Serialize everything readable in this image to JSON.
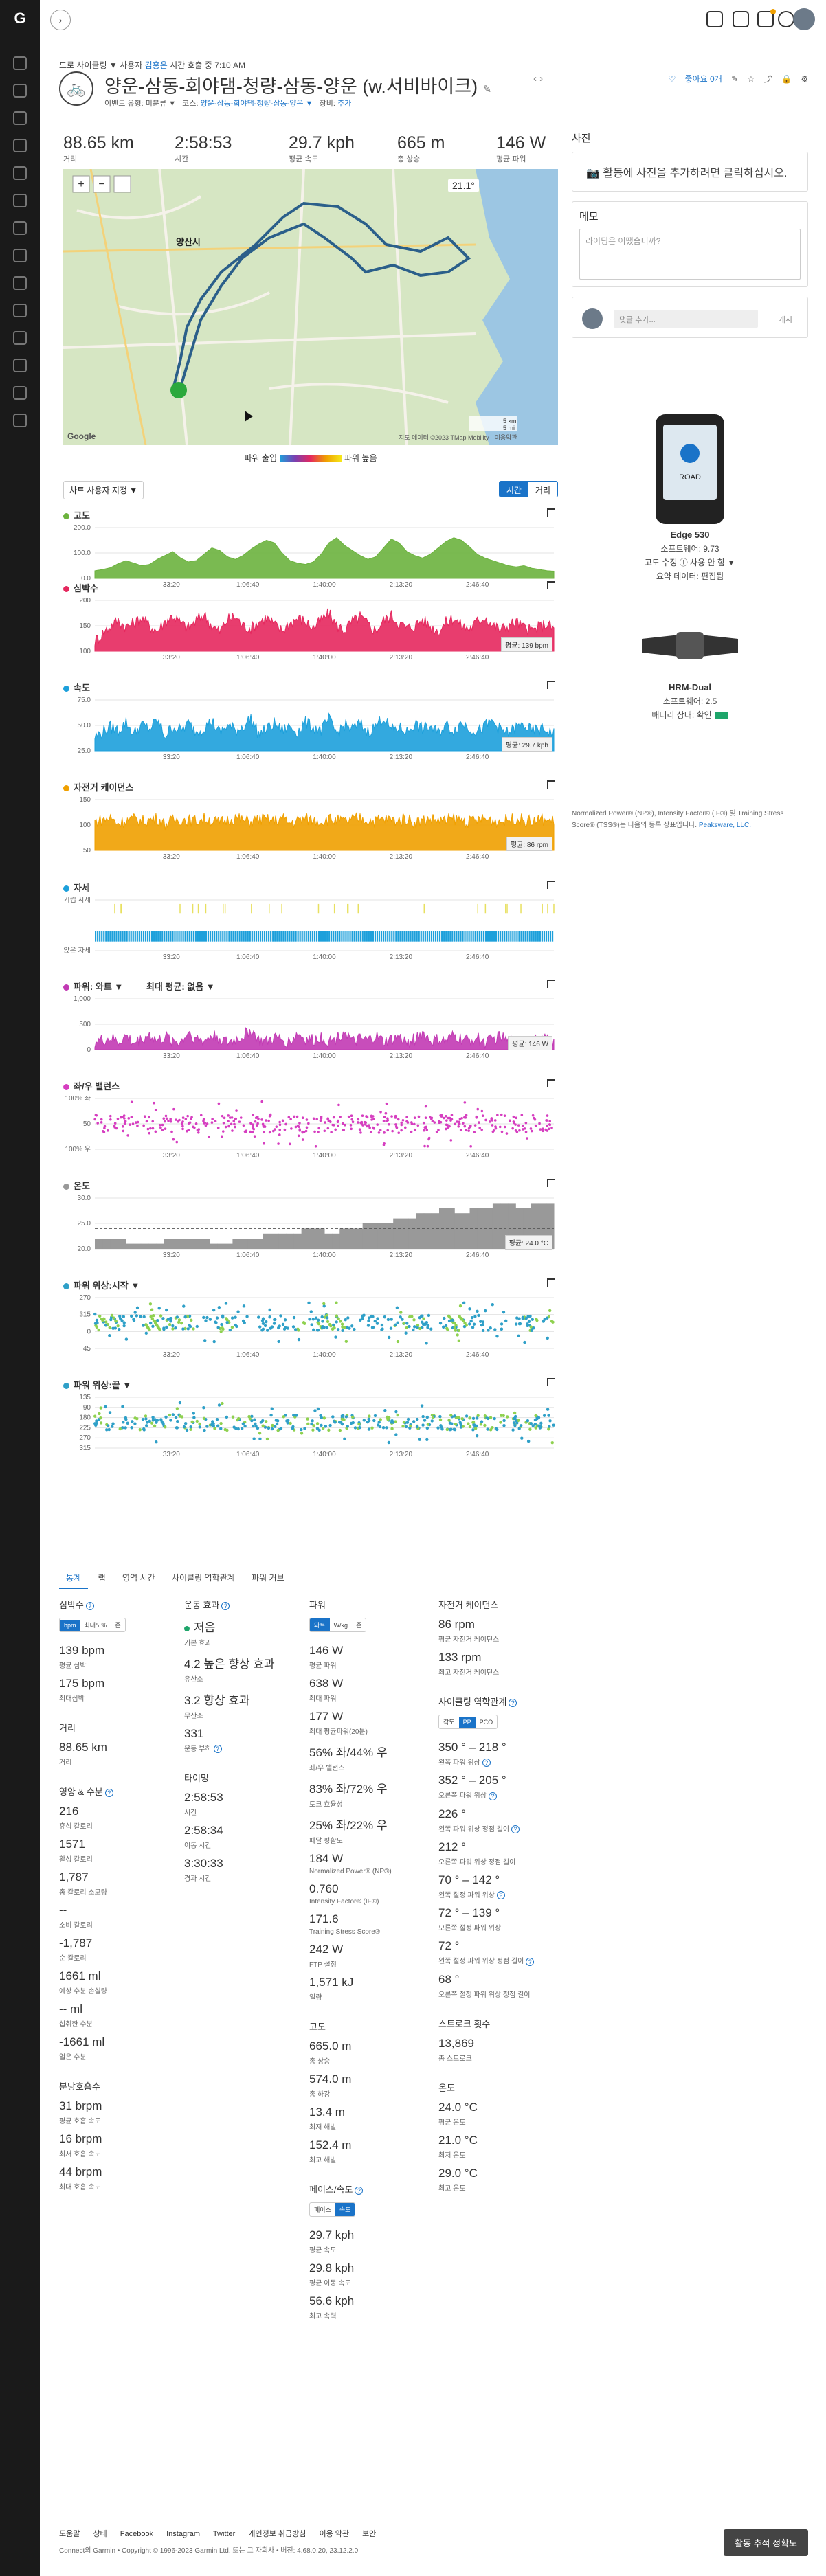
{
  "nav": {
    "logo": "G"
  },
  "header": {
    "toggle_icon": "chevron-right-icon"
  },
  "breadcrumb": {
    "category": "도로 사이클링",
    "created_by": "▼ 사용자",
    "link": "김홍은",
    "time_note": "시간 호출 중 7:10 AM"
  },
  "activity": {
    "title": "양운-삼동-회야댐-청량-삼동-양운 (w.서비바이크)",
    "edit_icon": "pencil-icon",
    "event_label": "이벤트 유형:",
    "event_value": "미분류 ▼",
    "course_label": "코스:",
    "course_value": "양운-삼동-회야댐-청량-삼동-양운 ▼",
    "gear_label": "장비:",
    "gear_value": "추가",
    "likes": "좋아요 0개",
    "pager": "‹   ›"
  },
  "stats": [
    {
      "value": "88.65 km",
      "label": "거리"
    },
    {
      "value": "2:58:53",
      "label": "시간"
    },
    {
      "value": "29.7 kph",
      "label": "평균 속도"
    },
    {
      "value": "665 m",
      "label": "총 상승"
    },
    {
      "value": "146 W",
      "label": "평균 파워"
    }
  ],
  "map": {
    "temperature": "21.1°",
    "attribution": "지도 데이터 ©2023 TMap Mobility · 이용약관",
    "google": "Google",
    "scale_a": "5 km",
    "scale_b": "5 mi",
    "city_label": "양산시"
  },
  "legend": {
    "low": "파워 출입",
    "high": "파워 높음"
  },
  "controls": {
    "overlay_select": "차트 사용자 지정 ▼",
    "time_label": "시간",
    "distance_label": "거리"
  },
  "charts": [
    {
      "key": "elev",
      "title": "고도",
      "color": "#6cb33e",
      "type": "area",
      "yticks": [
        "200.0",
        "100.0",
        "0.0"
      ],
      "ymax": 200,
      "values": [
        30,
        35,
        42,
        58,
        70,
        60,
        50,
        55,
        75,
        90,
        105,
        80,
        65,
        70,
        95,
        120,
        110,
        85,
        75,
        90,
        115,
        135,
        150,
        140,
        100,
        70,
        60,
        55,
        65,
        95,
        140,
        160,
        130,
        110,
        90,
        75,
        85,
        120,
        155,
        140,
        105,
        90,
        80,
        95,
        120,
        145,
        160,
        150,
        125,
        95,
        80,
        70,
        60,
        50,
        45,
        50,
        40,
        35,
        30,
        28
      ],
      "badge": ""
    },
    {
      "key": "hr",
      "title": "심박수",
      "color": "#e5285e",
      "type": "area",
      "yticks": [
        "200",
        "150",
        "100"
      ],
      "ymin": 100,
      "ymax": 200,
      "values": [
        120,
        135,
        150,
        160,
        148,
        155,
        165,
        150,
        140,
        158,
        170,
        155,
        145,
        160,
        172,
        150,
        138,
        162,
        168,
        150,
        145,
        158,
        166,
        152,
        140,
        155,
        165,
        158,
        146,
        160,
        174,
        150,
        142,
        158,
        168,
        152,
        140,
        160,
        170,
        155,
        145,
        150,
        162,
        148,
        140,
        156,
        166,
        150,
        144,
        158,
        168,
        150,
        142,
        150,
        158,
        146,
        140,
        148,
        154,
        140
      ],
      "badge": "평균: 139 bpm"
    },
    {
      "key": "spd",
      "title": "속도",
      "color": "#1da0db",
      "type": "area",
      "yticks": [
        "75.0",
        "50.0",
        "25.0"
      ],
      "ymax": 75,
      "values": [
        20,
        28,
        35,
        30,
        42,
        25,
        38,
        32,
        45,
        22,
        36,
        30,
        40,
        28,
        34,
        44,
        26,
        38,
        30,
        36,
        48,
        24,
        32,
        40,
        30,
        36,
        28,
        42,
        34,
        30,
        46,
        26,
        38,
        32,
        40,
        28,
        36,
        50,
        30,
        34,
        28,
        40,
        32,
        36,
        26,
        38,
        30,
        42,
        34,
        28,
        36,
        44,
        30,
        26,
        34,
        38,
        28,
        32,
        30,
        24
      ],
      "badge": "평균: 29.7 kph"
    },
    {
      "key": "cad",
      "title": "자전거 케이던스",
      "color": "#f0a000",
      "type": "area",
      "yticks": [
        "150",
        "100",
        "50"
      ],
      "ymax": 150,
      "values": [
        85,
        90,
        95,
        80,
        88,
        92,
        86,
        90,
        94,
        78,
        88,
        92,
        90,
        86,
        94,
        88,
        82,
        90,
        96,
        88,
        84,
        92,
        90,
        86,
        94,
        80,
        88,
        92,
        90,
        86,
        92,
        88,
        84,
        90,
        94,
        88,
        86,
        92,
        90,
        88,
        94,
        82,
        88,
        92,
        90,
        86,
        94,
        88,
        84,
        90,
        92,
        88,
        86,
        90,
        94,
        88,
        84,
        90,
        88,
        86
      ],
      "badge": "평균: 86 rpm"
    },
    {
      "key": "pos",
      "title": "자세",
      "color": "#1da0db",
      "type": "posture",
      "yticks": [
        "기립 자세",
        "앉은 자세"
      ],
      "ymax": 1,
      "values": [],
      "badge": ""
    },
    {
      "key": "pwr",
      "title": "파워: 와트 ▼",
      "title2": "최대 평균: 없음 ▼",
      "color": "#c23ab4",
      "type": "area",
      "yticks": [
        "1,000",
        "500",
        "0"
      ],
      "ymax": 1000,
      "values": [
        150,
        180,
        220,
        140,
        260,
        120,
        200,
        300,
        160,
        240,
        180,
        140,
        350,
        200,
        160,
        280,
        220,
        130,
        190,
        260,
        400,
        170,
        150,
        230,
        190,
        140,
        310,
        200,
        180,
        250,
        160,
        220,
        380,
        140,
        200,
        170,
        260,
        150,
        190,
        240,
        120,
        210,
        330,
        160,
        190,
        150,
        270,
        200,
        180,
        230,
        140,
        200,
        260,
        150,
        170,
        220,
        130,
        180,
        200,
        140
      ],
      "badge": "평균: 146 W"
    },
    {
      "key": "bal",
      "title": "좌/우 밸런스",
      "color": "#d63ec0",
      "type": "scatter",
      "yticks": [
        "100% 좌",
        "50",
        "100% 우"
      ],
      "ymax": 100,
      "values": [],
      "badge": ""
    },
    {
      "key": "temp",
      "title": "온도",
      "color": "#999999",
      "type": "step",
      "yticks": [
        "30.0",
        "25.0",
        "20.0"
      ],
      "ymin": 20,
      "ymax": 30,
      "values": [
        22,
        22,
        22,
        22,
        21,
        21,
        21,
        21,
        21,
        22,
        22,
        22,
        22,
        22,
        22,
        21,
        21,
        21,
        22,
        22,
        22,
        22,
        23,
        23,
        23,
        23,
        23,
        24,
        24,
        24,
        23,
        23,
        24,
        24,
        24,
        25,
        25,
        25,
        25,
        26,
        26,
        26,
        27,
        27,
        27,
        28,
        28,
        27,
        27,
        28,
        28,
        28,
        29,
        29,
        29,
        28,
        28,
        29,
        29,
        29
      ],
      "badge": "평균: 24.0 °C"
    },
    {
      "key": "ppstart",
      "title": "파워 위상:시작 ▼",
      "color": "#2fa0c8",
      "type": "dual",
      "yticks": [
        "270",
        "315",
        "0",
        "45"
      ],
      "ymax": 1,
      "values": [],
      "badge": ""
    },
    {
      "key": "ppend",
      "title": "파워 위상:끝 ▼",
      "color": "#2fa0c8",
      "type": "dual",
      "yticks": [
        "135",
        "90",
        "180",
        "225",
        "270",
        "315"
      ],
      "ymax": 1,
      "values": [],
      "badge": ""
    }
  ],
  "chart_axis": {
    "xticks": [
      "33:20",
      "1:06:40",
      "1:40:00",
      "2:13:20",
      "2:46:40"
    ]
  },
  "tabs": [
    "통계",
    "랩",
    "영역 시간",
    "사이클링 역학관계",
    "파워 커브"
  ],
  "stat_columns": [
    [
      {
        "kind": "head",
        "text": "심박수",
        "qm": true
      },
      {
        "kind": "toggle",
        "items": [
          "bpm",
          "최대도%",
          "존"
        ],
        "on": 0
      },
      {
        "kind": "val",
        "v": "139 bpm",
        "l": "평균 심박"
      },
      {
        "kind": "val",
        "v": "175 bpm",
        "l": "최대심박"
      },
      {
        "kind": "head",
        "text": "거리",
        "gap": true
      },
      {
        "kind": "val",
        "v": "88.65 km",
        "l": "거리"
      },
      {
        "kind": "head",
        "text": "영양 & 수분",
        "qm": true,
        "gap": true
      },
      {
        "kind": "val",
        "v": "216",
        "l": "휴식 칼로리"
      },
      {
        "kind": "val",
        "v": "1571",
        "l": "활성 칼로리"
      },
      {
        "kind": "val",
        "v": "1,787",
        "l": "총 칼로리 소모량"
      },
      {
        "kind": "val",
        "v": "--",
        "l": "소비 칼로리"
      },
      {
        "kind": "val",
        "v": "-1,787",
        "l": "순 칼로리"
      },
      {
        "kind": "val",
        "v": "1661 ml",
        "l": "예상 수분 손실량"
      },
      {
        "kind": "val",
        "v": "-- ml",
        "l": "섭취한 수분"
      },
      {
        "kind": "val",
        "v": "-1661 ml",
        "l": "얼은 수분"
      },
      {
        "kind": "head",
        "text": "분당호흡수",
        "gap": true
      },
      {
        "kind": "val",
        "v": "31 brpm",
        "l": "평균 호흡 속도"
      },
      {
        "kind": "val",
        "v": "16 brpm",
        "l": "최저 호흡 속도"
      },
      {
        "kind": "val",
        "v": "44 brpm",
        "l": "최대 호흡 속도"
      }
    ],
    [
      {
        "kind": "head",
        "text": "운동 효과",
        "qm": true
      },
      {
        "kind": "valdot",
        "v": "저음",
        "l": "기본 효과"
      },
      {
        "kind": "val",
        "v": "4.2 높은 향상 효과",
        "l": "유산소"
      },
      {
        "kind": "val",
        "v": "3.2 향상 효과",
        "l": "무산소"
      },
      {
        "kind": "val",
        "v": "331",
        "l": "운동 부하",
        "qm": true
      },
      {
        "kind": "head",
        "text": "타이밍",
        "gap": true
      },
      {
        "kind": "val",
        "v": "2:58:53",
        "l": "시간"
      },
      {
        "kind": "val",
        "v": "2:58:34",
        "l": "이동 시간"
      },
      {
        "kind": "val",
        "v": "3:30:33",
        "l": "경과 시간"
      }
    ],
    [
      {
        "kind": "head",
        "text": "파워"
      },
      {
        "kind": "toggle",
        "items": [
          "와트",
          "W/kg",
          "존"
        ],
        "on": 0
      },
      {
        "kind": "val",
        "v": "146 W",
        "l": "평균 파워"
      },
      {
        "kind": "val",
        "v": "638 W",
        "l": "최대 파워"
      },
      {
        "kind": "val",
        "v": "177 W",
        "l": "최대 평균파워(20분)"
      },
      {
        "kind": "val",
        "v": "56% 좌/44% 우",
        "l": "좌/우 밸런스"
      },
      {
        "kind": "val",
        "v": "83% 좌/72% 우",
        "l": "토크 효율성"
      },
      {
        "kind": "val",
        "v": "25% 좌/22% 우",
        "l": "페달 평활도"
      },
      {
        "kind": "val",
        "v": "184 W",
        "l": "Normalized Power® (NP®)"
      },
      {
        "kind": "val",
        "v": "0.760",
        "l": "Intensity Factor® (IF®)"
      },
      {
        "kind": "val",
        "v": "171.6",
        "l": "Training Stress Score®"
      },
      {
        "kind": "val",
        "v": "242 W",
        "l": "FTP 설정"
      },
      {
        "kind": "val",
        "v": "1,571 kJ",
        "l": "일량"
      },
      {
        "kind": "head",
        "text": "고도",
        "gap": true
      },
      {
        "kind": "val",
        "v": "665.0 m",
        "l": "총 상승"
      },
      {
        "kind": "val",
        "v": "574.0 m",
        "l": "총 하강"
      },
      {
        "kind": "val",
        "v": "13.4 m",
        "l": "최저 해발"
      },
      {
        "kind": "val",
        "v": "152.4 m",
        "l": "최고 해발"
      },
      {
        "kind": "head",
        "text": "페이스/속도",
        "qm": true,
        "gap": true
      },
      {
        "kind": "toggle",
        "items": [
          "페이스",
          "속도"
        ],
        "on": 1
      },
      {
        "kind": "val",
        "v": "29.7 kph",
        "l": "평균 속도"
      },
      {
        "kind": "val",
        "v": "29.8 kph",
        "l": "평균 이동 속도"
      },
      {
        "kind": "val",
        "v": "56.6 kph",
        "l": "최고 속력"
      }
    ],
    [
      {
        "kind": "head",
        "text": "자전거 케이던스"
      },
      {
        "kind": "val",
        "v": "86 rpm",
        "l": "평균 자전거 케이던스"
      },
      {
        "kind": "val",
        "v": "133 rpm",
        "l": "최고 자전거 케이던스"
      },
      {
        "kind": "head",
        "text": "사이클링 역학관계",
        "qm": true,
        "gap": true
      },
      {
        "kind": "toggle",
        "items": [
          "각도",
          "PP",
          "PCO"
        ],
        "on": 1
      },
      {
        "kind": "val",
        "v": "350 ° – 218 °",
        "l": "왼쪽 파워 위상",
        "qm": true
      },
      {
        "kind": "val",
        "v": "352 ° – 205 °",
        "l": "오른쪽 파워 위상",
        "qm": true
      },
      {
        "kind": "val",
        "v": "226 °",
        "l": "왼쪽 파워 위상 정점 길이",
        "qm": true
      },
      {
        "kind": "val",
        "v": "212 °",
        "l": "오른쪽 파워 위상 정점 길이"
      },
      {
        "kind": "val",
        "v": "70 ° – 142 °",
        "l": "왼쪽 절정 파워 위상",
        "qm": true
      },
      {
        "kind": "val",
        "v": "72 ° – 139 °",
        "l": "오른쪽 절정 파워 위상"
      },
      {
        "kind": "val",
        "v": "72 °",
        "l": "왼쪽 절정 파워 위상 정점 길이",
        "qm": true
      },
      {
        "kind": "val",
        "v": "68 °",
        "l": "오른쪽 절정 파워 위상 정점 길이"
      },
      {
        "kind": "head",
        "text": "스트로크 횟수",
        "gap": true
      },
      {
        "kind": "val",
        "v": "13,869",
        "l": "총 스트로크"
      },
      {
        "kind": "head",
        "text": "온도",
        "gap": true
      },
      {
        "kind": "val",
        "v": "24.0 °C",
        "l": "평균 온도"
      },
      {
        "kind": "val",
        "v": "21.0 °C",
        "l": "최저 온도"
      },
      {
        "kind": "val",
        "v": "29.0 °C",
        "l": "최고 온도"
      }
    ]
  ],
  "right": {
    "photos_title": "사진",
    "photos_text": "활동에 사진을 추가하려면 클릭하십시오.",
    "notes_title": "메모",
    "notes_placeholder": "라이딩은 어땠습니까?",
    "comment_placeholder": "댓글 추가...",
    "comment_post": "게시",
    "device1": {
      "name": "Edge 530",
      "sw": "소프트웨어: 9.73",
      "elev": "고도 수정 ⓘ 사용 안 함 ▼",
      "summary": "요약 데이터: 편집됨"
    },
    "device2": {
      "name": "HRM-Dual",
      "sw": "소프트웨어: 2.5",
      "battery": "배터리 상태: 확인"
    },
    "credits": "Normalized Power® (NP®), Intensity Factor® (IF®) 및 Training Stress Score® (TSS®)는 다음의 등록 상표입니다.",
    "credits_link": "Peaksware, LLC."
  },
  "footer": {
    "links": [
      "도움말",
      "상태",
      "Facebook",
      "Instagram",
      "Twitter",
      "개인정보 취급방침",
      "이용 약관",
      "보안"
    ],
    "copyright": "Connect의 Garmin • Copyright © 1996-2023 Garmin Ltd. 또는 그 자회사 • 버전: 4.68.0.20, 23.12.2.0",
    "feedback": "활동 추적 정확도"
  }
}
